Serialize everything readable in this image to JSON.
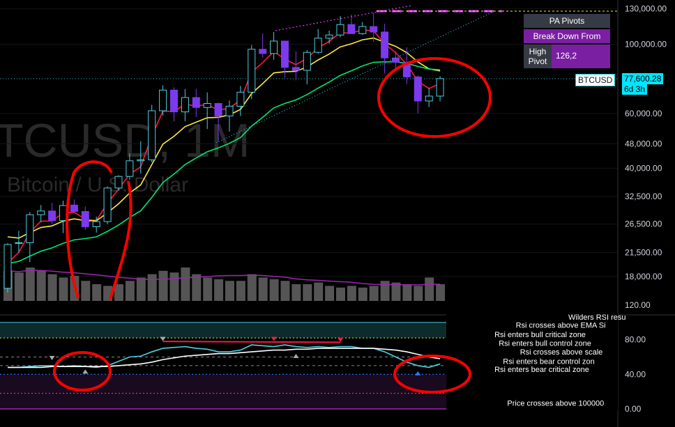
{
  "symbol_watermark": "TCUSD, 1M",
  "symbol_subtitle": "Bitcoin / U.S. Dollar",
  "pivot_table": {
    "title": "PA Pivots",
    "status": "Break Down From",
    "row_label": "High Pivot",
    "row_value": "126,2"
  },
  "current_price": {
    "label": "77,600.28",
    "countdown": "6d 3h",
    "ticker": "BTCUSD"
  },
  "colors": {
    "candle_up": "#4dd0e1",
    "candle_down": "#7c3aed",
    "ema_fast": "#ff1744",
    "ema_mid": "#ffeb3b",
    "ema_slow": "#00e676",
    "volume": "#555555",
    "volume_ma": "#9c27b0",
    "rsi": "#4dd0e1",
    "rsi_signal": "#ffffff",
    "annotation": "#ff0000"
  },
  "chart_data": [
    {
      "type": "candlestick",
      "title": "TCUSD, 1M",
      "y_scale": "log",
      "ylim": [
        14000,
        150000
      ],
      "y_ticks": [
        "130,000.00",
        "100,000.00",
        "77,600.28",
        "60,000.00",
        "48,000.00",
        "40,000.00",
        "32,500.00",
        "26,500.00",
        "21,500.00",
        "18,000.00"
      ],
      "y_tick_values": [
        130000,
        100000,
        77600,
        60000,
        48000,
        40000,
        32500,
        26500,
        21500,
        18000
      ],
      "candles": [
        {
          "o": 16500,
          "h": 23000,
          "l": 16000,
          "c": 22800
        },
        {
          "o": 23000,
          "h": 25200,
          "l": 21500,
          "c": 23100
        },
        {
          "o": 23100,
          "h": 29000,
          "l": 20000,
          "c": 28400
        },
        {
          "o": 28400,
          "h": 30500,
          "l": 26900,
          "c": 29200
        },
        {
          "o": 29200,
          "h": 31000,
          "l": 26500,
          "c": 27200
        },
        {
          "o": 27200,
          "h": 31500,
          "l": 24800,
          "c": 30400
        },
        {
          "o": 30500,
          "h": 31800,
          "l": 28800,
          "c": 29100
        },
        {
          "o": 29100,
          "h": 30200,
          "l": 25400,
          "c": 26000
        },
        {
          "o": 26000,
          "h": 28000,
          "l": 24900,
          "c": 27000
        },
        {
          "o": 27000,
          "h": 35000,
          "l": 26500,
          "c": 34600
        },
        {
          "o": 34600,
          "h": 38000,
          "l": 34000,
          "c": 37700
        },
        {
          "o": 37700,
          "h": 44700,
          "l": 36800,
          "c": 42300
        },
        {
          "o": 42300,
          "h": 48900,
          "l": 38500,
          "c": 42600
        },
        {
          "o": 42600,
          "h": 63900,
          "l": 41900,
          "c": 61200
        },
        {
          "o": 61200,
          "h": 73800,
          "l": 59000,
          "c": 71300
        },
        {
          "o": 71300,
          "h": 72800,
          "l": 56500,
          "c": 60700
        },
        {
          "o": 60700,
          "h": 71900,
          "l": 56600,
          "c": 67500
        },
        {
          "o": 67500,
          "h": 71900,
          "l": 58400,
          "c": 62700
        },
        {
          "o": 62700,
          "h": 70100,
          "l": 53500,
          "c": 64600
        },
        {
          "o": 64600,
          "h": 65000,
          "l": 49000,
          "c": 58900
        },
        {
          "o": 58900,
          "h": 66000,
          "l": 52500,
          "c": 63300
        },
        {
          "o": 63300,
          "h": 73600,
          "l": 58900,
          "c": 70200
        },
        {
          "o": 70200,
          "h": 99500,
          "l": 66800,
          "c": 96400
        },
        {
          "o": 96400,
          "h": 108300,
          "l": 90500,
          "c": 93400
        },
        {
          "o": 93400,
          "h": 109500,
          "l": 89200,
          "c": 102400
        },
        {
          "o": 102400,
          "h": 102800,
          "l": 78200,
          "c": 84300
        },
        {
          "o": 84300,
          "h": 95000,
          "l": 76600,
          "c": 82500
        },
        {
          "o": 82500,
          "h": 95800,
          "l": 74400,
          "c": 94200
        },
        {
          "o": 94200,
          "h": 111900,
          "l": 93400,
          "c": 104600
        },
        {
          "o": 104600,
          "h": 110600,
          "l": 100300,
          "c": 107100
        },
        {
          "o": 107100,
          "h": 123200,
          "l": 105300,
          "c": 115700
        },
        {
          "o": 115700,
          "h": 124500,
          "l": 108000,
          "c": 108200
        },
        {
          "o": 108200,
          "h": 117900,
          "l": 107300,
          "c": 114000
        },
        {
          "o": 114000,
          "h": 126200,
          "l": 102000,
          "c": 109500
        },
        {
          "o": 109500,
          "h": 116400,
          "l": 80600,
          "c": 90400
        },
        {
          "o": 90400,
          "h": 94600,
          "l": 84000,
          "c": 87600
        },
        {
          "o": 87600,
          "h": 97900,
          "l": 74500,
          "c": 78600
        },
        {
          "o": 78600,
          "h": 79300,
          "l": 60100,
          "c": 65800
        },
        {
          "o": 65800,
          "h": 72300,
          "l": 62900,
          "c": 68200
        },
        {
          "o": 68200,
          "h": 78900,
          "l": 65600,
          "c": 77600
        }
      ],
      "volume": [
        9,
        8.5,
        10,
        9,
        8,
        7,
        7.5,
        6,
        5,
        4.5,
        5,
        6,
        7,
        8,
        9,
        8.5,
        10,
        8,
        7,
        6.5,
        6,
        6,
        8,
        7,
        6.5,
        6,
        5,
        5,
        5.5,
        4.5,
        4,
        4.5,
        4,
        4.5,
        6,
        5.5,
        5,
        4.5,
        7,
        5
      ]
    },
    {
      "type": "line",
      "title": "Wilders RSI resu",
      "ylim": [
        0,
        120
      ],
      "y_ticks": [
        "120.00",
        "80.00",
        "40.00",
        "0.00"
      ],
      "y_tick_values": [
        120,
        80,
        40,
        0
      ],
      "series": [
        {
          "values": [
            48,
            48,
            49,
            50,
            50,
            49,
            50,
            49,
            48,
            50,
            55,
            60,
            61,
            66,
            70,
            71,
            72,
            70,
            69,
            66,
            66,
            68,
            74,
            73,
            72,
            74,
            72,
            71,
            72,
            71,
            72,
            72,
            70,
            70,
            66,
            60,
            54,
            50,
            48,
            52
          ]
        },
        {
          "values": [
            48,
            48,
            48,
            48,
            49,
            49,
            49,
            49,
            49,
            49,
            50,
            51,
            52,
            54,
            57,
            59,
            61,
            62,
            63,
            64,
            64,
            65,
            66,
            67,
            68,
            68,
            69,
            69,
            70,
            70,
            70,
            70,
            70,
            70,
            69,
            68,
            66,
            63,
            60,
            58
          ]
        }
      ],
      "legend_labels": [
        "Rsi crosses above EMA Si",
        "Rsi enters bull critical zone",
        "Rsi enters bull control zone",
        "Rsi crosses above scale",
        "Rsi enters bear control zon",
        "Rsi enters bear critical zone",
        "Price crosses above 100000"
      ]
    }
  ]
}
